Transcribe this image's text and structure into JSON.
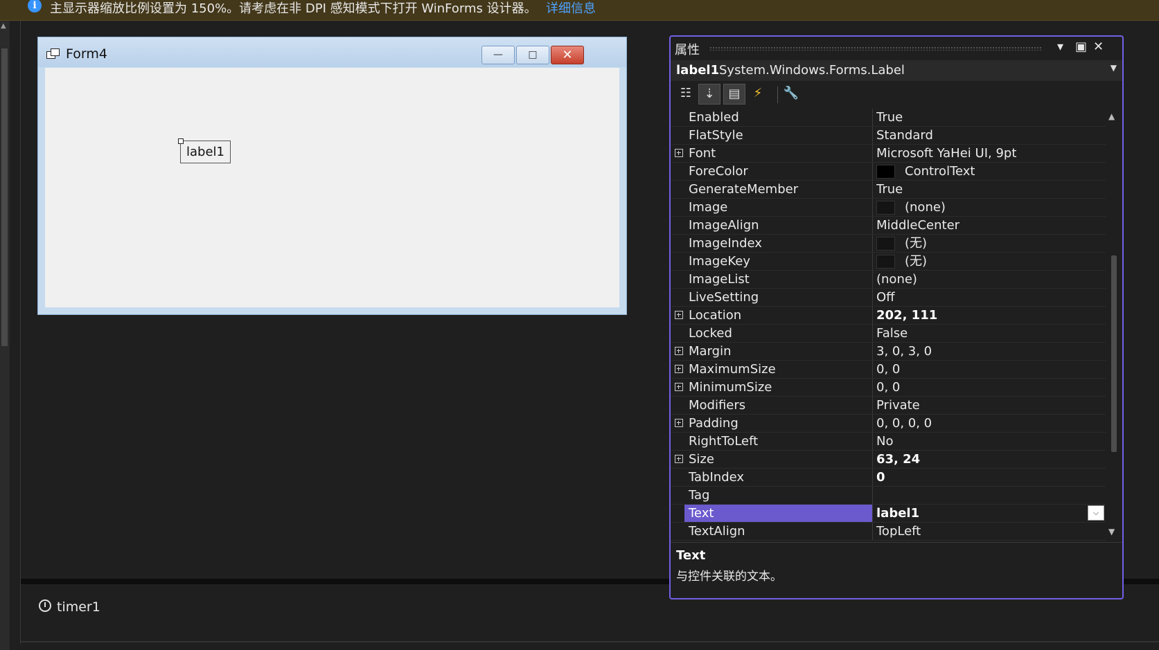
{
  "infobar": {
    "icon": "info-icon",
    "message": "主显示器缩放比例设置为 150%。请考虑在非 DPI 感知模式下打开 WinForms 设计器。",
    "link": "详细信息"
  },
  "form": {
    "title": "Form4",
    "buttons": {
      "minimize": "—",
      "maximize": "□",
      "close": "✕"
    },
    "label1_text": "label1"
  },
  "tray": {
    "component": "timer1"
  },
  "properties": {
    "title": "属性",
    "header_buttons": {
      "dropdown": "▾",
      "maximize": "▣",
      "close": "✕"
    },
    "selected_object": {
      "name": "label1",
      "type": "System.Windows.Forms.Label"
    },
    "toolbar": [
      "categorized",
      "alphabetical",
      "properties",
      "events",
      "property-pages"
    ],
    "rows": [
      {
        "name": "Enabled",
        "value": "True"
      },
      {
        "name": "FlatStyle",
        "value": "Standard"
      },
      {
        "name": "Font",
        "value": "Microsoft YaHei UI, 9pt",
        "expandable": true
      },
      {
        "name": "ForeColor",
        "value": "ControlText",
        "swatch": "#000000"
      },
      {
        "name": "GenerateMember",
        "value": "True"
      },
      {
        "name": "Image",
        "value": "(none)",
        "swatch": "#141414"
      },
      {
        "name": "ImageAlign",
        "value": "MiddleCenter"
      },
      {
        "name": "ImageIndex",
        "value": "(无)",
        "swatch": "#141414"
      },
      {
        "name": "ImageKey",
        "value": "(无)",
        "swatch": "#141414"
      },
      {
        "name": "ImageList",
        "value": "(none)"
      },
      {
        "name": "LiveSetting",
        "value": "Off"
      },
      {
        "name": "Location",
        "value": "202, 111",
        "expandable": true,
        "bold": true
      },
      {
        "name": "Locked",
        "value": "False"
      },
      {
        "name": "Margin",
        "value": "3, 0, 3, 0",
        "expandable": true
      },
      {
        "name": "MaximumSize",
        "value": "0, 0",
        "expandable": true
      },
      {
        "name": "MinimumSize",
        "value": "0, 0",
        "expandable": true
      },
      {
        "name": "Modifiers",
        "value": "Private"
      },
      {
        "name": "Padding",
        "value": "0, 0, 0, 0",
        "expandable": true
      },
      {
        "name": "RightToLeft",
        "value": "No"
      },
      {
        "name": "Size",
        "value": "63, 24",
        "expandable": true,
        "bold": true
      },
      {
        "name": "TabIndex",
        "value": "0",
        "bold": true
      },
      {
        "name": "Tag",
        "value": ""
      },
      {
        "name": "Text",
        "value": "label1",
        "bold": true,
        "selected": true
      },
      {
        "name": "TextAlign",
        "value": "TopLeft"
      }
    ],
    "description": {
      "title": "Text",
      "text": "与控件关联的文本。"
    }
  },
  "colors": {
    "accent": "#7160e8",
    "selected_row": "#6a5acd",
    "link": "#4da3ff"
  }
}
